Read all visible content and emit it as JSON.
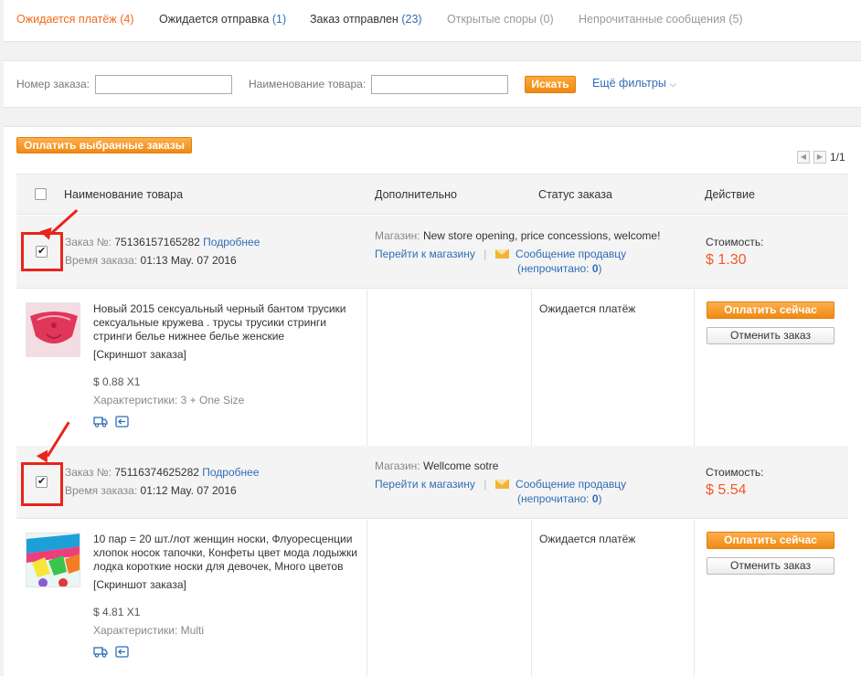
{
  "tabs": [
    {
      "label": "Ожидается платёж",
      "count": "(4)",
      "state": "active"
    },
    {
      "label": "Ожидается отправка",
      "count": "(1)",
      "state": "normal"
    },
    {
      "label": "Заказ отправлен",
      "count": "(23)",
      "state": "normal"
    },
    {
      "label": "Открытые споры",
      "count": "(0)",
      "state": "disabled"
    },
    {
      "label": "Непрочитанные сообщения",
      "count": "(5)",
      "state": "disabled"
    }
  ],
  "filters": {
    "order_no_label": "Номер заказа:",
    "order_no_value": "",
    "product_label": "Наименование товара:",
    "product_value": "",
    "search_label": "Искать",
    "more_filters_label": "Ещё фильтры"
  },
  "toolbar": {
    "pay_selected_label": "Оплатить выбранные заказы",
    "pager_text": "1/1"
  },
  "table_headers": {
    "product": "Наименование товара",
    "additional": "Дополнительно",
    "status": "Статус заказа",
    "action": "Действие"
  },
  "orders": [
    {
      "checked": true,
      "order_no_label": "Заказ №:",
      "order_no": "75136157165282",
      "details_link": "Подробнее",
      "time_label": "Время заказа:",
      "time": "01:13 May. 07 2016",
      "shop_label": "Магазин:",
      "shop_name": "New store opening, price concessions, welcome!",
      "go_to_store": "Перейти к магазину",
      "separator": "|",
      "message_seller": "Сообщение продавцу",
      "unread_prefix": "(непрочитано: ",
      "unread_count": "0",
      "unread_suffix": ")",
      "cost_label": "Стоимость:",
      "cost": "$ 1.30",
      "product_title": "Новый 2015 сексуальный черный бантом трусики сексуальные кружева . трусы трусики стринги стринги белье нижнее белье женские",
      "snapshot": "[Скриншот заказа]",
      "unit_price": "$ 0.88 X1",
      "specs": "Характеристики: 3 + One Size",
      "status": "Ожидается платёж",
      "pay_now": "Оплатить сейчас",
      "cancel": "Отменить заказ"
    },
    {
      "checked": true,
      "order_no_label": "Заказ №:",
      "order_no": "75116374625282",
      "details_link": "Подробнее",
      "time_label": "Время заказа:",
      "time": "01:12 May. 07 2016",
      "shop_label": "Магазин:",
      "shop_name": "Wellcome sotre",
      "go_to_store": "Перейти к магазину",
      "separator": "|",
      "message_seller": "Сообщение продавцу",
      "unread_prefix": "(непрочитано: ",
      "unread_count": "0",
      "unread_suffix": ")",
      "cost_label": "Стоимость:",
      "cost": "$ 5.54",
      "product_title": "10 пар = 20 шт./лот женщин носки, Флуоресценции хлопок носок тапочки, Конфеты цвет мода лодыжки лодка короткие носки для девочек, Много цветов",
      "snapshot": "[Скриншот заказа]",
      "unit_price": "$ 4.81 X1",
      "specs": "Характеристики: Multi",
      "status": "Ожидается платёж",
      "pay_now": "Оплатить сейчас",
      "cancel": "Отменить заказ"
    }
  ],
  "icons": {
    "shipping": "truck-icon",
    "return": "return-icon",
    "envelope": "envelope-icon",
    "chevron": "chevron-down-icon",
    "pager_prev": "chevron-left-icon",
    "pager_next": "chevron-right-icon"
  },
  "colors": {
    "accent_orange": "#f08a12",
    "active_tab": "#f06a1b",
    "link_blue": "#2f6db5",
    "price_red": "#f05a28",
    "annotation_red": "#e8251b"
  }
}
